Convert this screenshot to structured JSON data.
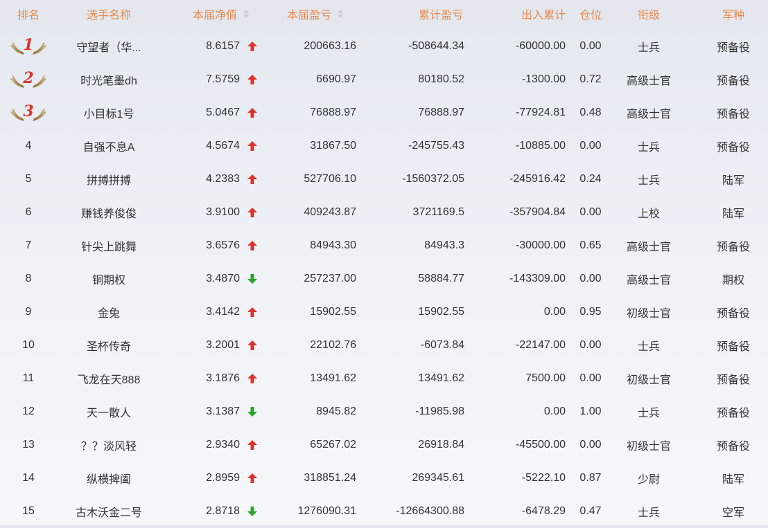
{
  "header": {
    "rank": "排名",
    "name": "选手名称",
    "nav": "本届净值",
    "pnl": "本届盈亏",
    "cumulative": "累计盈亏",
    "flow": "出入累计",
    "position": "仓位",
    "title": "衔级",
    "branch": "军种"
  },
  "colors": {
    "header_text": "#e8894a",
    "up": "#e0322d",
    "down": "#2aa52a",
    "medal": "#e0322d"
  },
  "rows": [
    {
      "rank": "1",
      "medal": true,
      "name": "守望者（华...",
      "nav": "8.6157",
      "trend": "up",
      "pnl": "200663.16",
      "cumulative": "-508644.34",
      "flow": "-60000.00",
      "position": "0.00",
      "title": "士兵",
      "branch": "预备役"
    },
    {
      "rank": "2",
      "medal": true,
      "name": "时光笔墨dh",
      "nav": "7.5759",
      "trend": "up",
      "pnl": "6690.97",
      "cumulative": "80180.52",
      "flow": "-1300.00",
      "position": "0.72",
      "title": "高级士官",
      "branch": "预备役"
    },
    {
      "rank": "3",
      "medal": true,
      "name": "小目标1号",
      "nav": "5.0467",
      "trend": "up",
      "pnl": "76888.97",
      "cumulative": "76888.97",
      "flow": "-77924.81",
      "position": "0.48",
      "title": "高级士官",
      "branch": "预备役"
    },
    {
      "rank": "4",
      "medal": false,
      "name": "自强不息A",
      "nav": "4.5674",
      "trend": "up",
      "pnl": "31867.50",
      "cumulative": "-245755.43",
      "flow": "-10885.00",
      "position": "0.00",
      "title": "士兵",
      "branch": "预备役"
    },
    {
      "rank": "5",
      "medal": false,
      "name": "拼搏拼搏",
      "nav": "4.2383",
      "trend": "up",
      "pnl": "527706.10",
      "cumulative": "-1560372.05",
      "flow": "-245916.42",
      "position": "0.24",
      "title": "士兵",
      "branch": "陆军"
    },
    {
      "rank": "6",
      "medal": false,
      "name": "赚钱养俊俊",
      "nav": "3.9100",
      "trend": "up",
      "pnl": "409243.87",
      "cumulative": "3721169.5",
      "flow": "-357904.84",
      "position": "0.00",
      "title": "上校",
      "branch": "陆军"
    },
    {
      "rank": "7",
      "medal": false,
      "name": "针尖上跳舞",
      "nav": "3.6576",
      "trend": "up",
      "pnl": "84943.30",
      "cumulative": "84943.3",
      "flow": "-30000.00",
      "position": "0.65",
      "title": "高级士官",
      "branch": "预备役"
    },
    {
      "rank": "8",
      "medal": false,
      "name": "铜期权",
      "nav": "3.4870",
      "trend": "down",
      "pnl": "257237.00",
      "cumulative": "58884.77",
      "flow": "-143309.00",
      "position": "0.00",
      "title": "高级士官",
      "branch": "期权"
    },
    {
      "rank": "9",
      "medal": false,
      "name": "金兔",
      "nav": "3.4142",
      "trend": "up",
      "pnl": "15902.55",
      "cumulative": "15902.55",
      "flow": "0.00",
      "position": "0.95",
      "title": "初级士官",
      "branch": "预备役"
    },
    {
      "rank": "10",
      "medal": false,
      "name": "圣杯传奇",
      "nav": "3.2001",
      "trend": "up",
      "pnl": "22102.76",
      "cumulative": "-6073.84",
      "flow": "-22147.00",
      "position": "0.00",
      "title": "士兵",
      "branch": "预备役"
    },
    {
      "rank": "11",
      "medal": false,
      "name": "飞龙在天888",
      "nav": "3.1876",
      "trend": "up",
      "pnl": "13491.62",
      "cumulative": "13491.62",
      "flow": "7500.00",
      "position": "0.00",
      "title": "初级士官",
      "branch": "预备役"
    },
    {
      "rank": "12",
      "medal": false,
      "name": "天一散人",
      "nav": "3.1387",
      "trend": "down",
      "pnl": "8945.82",
      "cumulative": "-11985.98",
      "flow": "0.00",
      "position": "1.00",
      "title": "士兵",
      "branch": "预备役"
    },
    {
      "rank": "13",
      "medal": false,
      "name": "？？淡风轻",
      "nav": "2.9340",
      "trend": "up",
      "pnl": "65267.02",
      "cumulative": "26918.84",
      "flow": "-45500.00",
      "position": "0.00",
      "title": "初级士官",
      "branch": "预备役"
    },
    {
      "rank": "14",
      "medal": false,
      "name": "纵横捭阖",
      "nav": "2.8959",
      "trend": "up",
      "pnl": "318851.24",
      "cumulative": "269345.61",
      "flow": "-5222.10",
      "position": "0.87",
      "title": "少尉",
      "branch": "陆军"
    },
    {
      "rank": "15",
      "medal": false,
      "name": "古木沃金二号",
      "nav": "2.8718",
      "trend": "down",
      "pnl": "1276090.31",
      "cumulative": "-12664300.88",
      "flow": "-6478.29",
      "position": "0.47",
      "title": "士兵",
      "branch": "空军"
    }
  ]
}
